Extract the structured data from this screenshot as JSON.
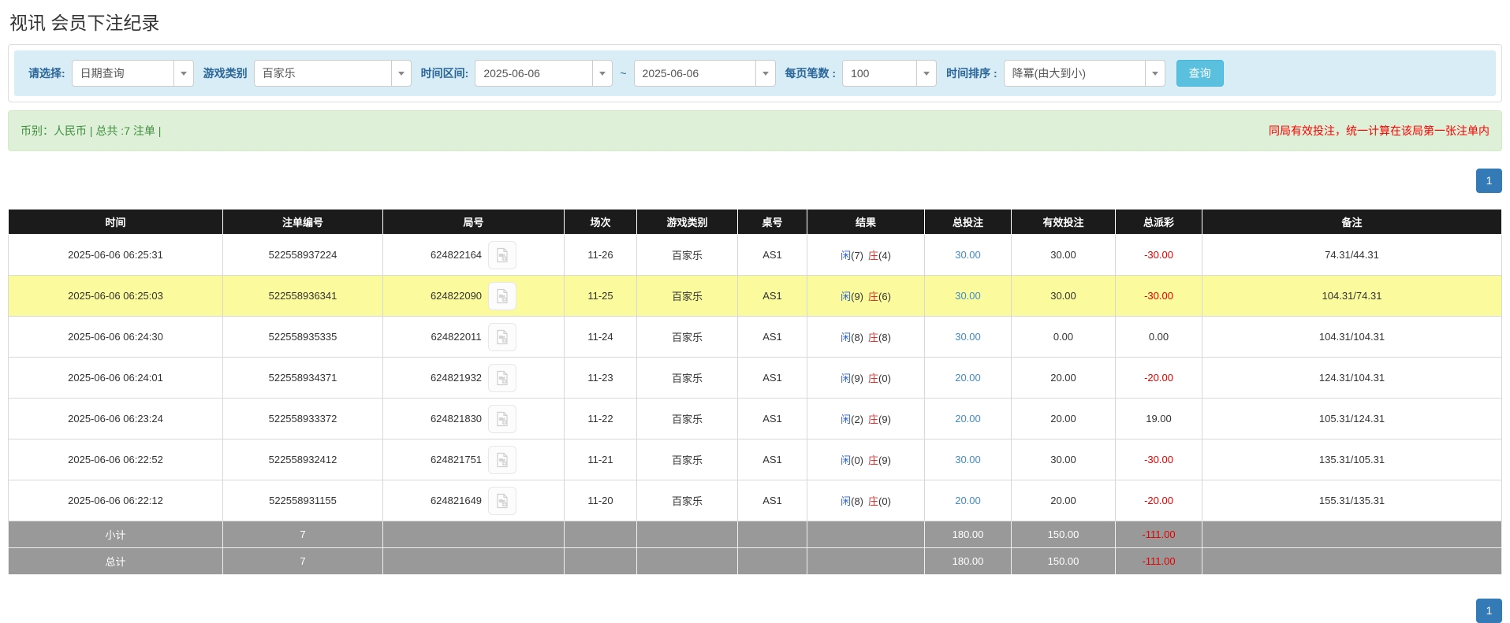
{
  "page": {
    "title": "视讯 会员下注纪录"
  },
  "filters": {
    "select_label": "请选择:",
    "select_value": "日期查询",
    "game_type_label": "游戏类别",
    "game_type_value": "百家乐",
    "date_range_label": "时间区间:",
    "date_from": "2025-06-06",
    "date_tilde": "~",
    "date_to": "2025-06-06",
    "page_size_label": "每页笔数 :",
    "page_size_value": "100",
    "sort_label": "时间排序 :",
    "sort_value": "降冪(由大到小)",
    "search_button": "查询"
  },
  "summary_bar": {
    "left_text": "币别：人民币 | 总共 :7 注单 |",
    "right_notice": "同局有效投注，统一计算在该局第一张注单内"
  },
  "pagination": {
    "page": "1"
  },
  "table": {
    "headers": [
      "时间",
      "注单编号",
      "局号",
      "场次",
      "游戏类别",
      "桌号",
      "结果",
      "总投注",
      "有效投注",
      "总派彩",
      "备注"
    ],
    "rows": [
      {
        "time": "2025-06-06 06:25:31",
        "bet_id": "522558937224",
        "round_id": "624822164",
        "session": "11-26",
        "game_type": "百家乐",
        "table_no": "AS1",
        "result": {
          "player_label": "闲",
          "player_score": "(7)",
          "banker_label": "庄",
          "banker_score": "(4)"
        },
        "total_bet": "30.00",
        "valid_bet": "30.00",
        "total_payout": "-30.00",
        "remark": "74.31/44.31",
        "highlighted": false
      },
      {
        "time": "2025-06-06 06:25:03",
        "bet_id": "522558936341",
        "round_id": "624822090",
        "session": "11-25",
        "game_type": "百家乐",
        "table_no": "AS1",
        "result": {
          "player_label": "闲",
          "player_score": "(9)",
          "banker_label": "庄",
          "banker_score": "(6)"
        },
        "total_bet": "30.00",
        "valid_bet": "30.00",
        "total_payout": "-30.00",
        "remark": "104.31/74.31",
        "highlighted": true
      },
      {
        "time": "2025-06-06 06:24:30",
        "bet_id": "522558935335",
        "round_id": "624822011",
        "session": "11-24",
        "game_type": "百家乐",
        "table_no": "AS1",
        "result": {
          "player_label": "闲",
          "player_score": "(8)",
          "banker_label": "庄",
          "banker_score": "(8)"
        },
        "total_bet": "30.00",
        "valid_bet": "0.00",
        "total_payout": "0.00",
        "remark": "104.31/104.31",
        "highlighted": false
      },
      {
        "time": "2025-06-06 06:24:01",
        "bet_id": "522558934371",
        "round_id": "624821932",
        "session": "11-23",
        "game_type": "百家乐",
        "table_no": "AS1",
        "result": {
          "player_label": "闲",
          "player_score": "(9)",
          "banker_label": "庄",
          "banker_score": "(0)"
        },
        "total_bet": "20.00",
        "valid_bet": "20.00",
        "total_payout": "-20.00",
        "remark": "124.31/104.31",
        "highlighted": false
      },
      {
        "time": "2025-06-06 06:23:24",
        "bet_id": "522558933372",
        "round_id": "624821830",
        "session": "11-22",
        "game_type": "百家乐",
        "table_no": "AS1",
        "result": {
          "player_label": "闲",
          "player_score": "(2)",
          "banker_label": "庄",
          "banker_score": "(9)"
        },
        "total_bet": "20.00",
        "valid_bet": "20.00",
        "total_payout": "19.00",
        "remark": "105.31/124.31",
        "highlighted": false
      },
      {
        "time": "2025-06-06 06:22:52",
        "bet_id": "522558932412",
        "round_id": "624821751",
        "session": "11-21",
        "game_type": "百家乐",
        "table_no": "AS1",
        "result": {
          "player_label": "闲",
          "player_score": "(0)",
          "banker_label": "庄",
          "banker_score": "(9)"
        },
        "total_bet": "30.00",
        "valid_bet": "30.00",
        "total_payout": "-30.00",
        "remark": "135.31/105.31",
        "highlighted": false
      },
      {
        "time": "2025-06-06 06:22:12",
        "bet_id": "522558931155",
        "round_id": "624821649",
        "session": "11-20",
        "game_type": "百家乐",
        "table_no": "AS1",
        "result": {
          "player_label": "闲",
          "player_score": "(8)",
          "banker_label": "庄",
          "banker_score": "(0)"
        },
        "total_bet": "20.00",
        "valid_bet": "20.00",
        "total_payout": "-20.00",
        "remark": "155.31/135.31",
        "highlighted": false
      }
    ],
    "subtotal": {
      "label": "小计",
      "count": "7",
      "total_bet": "180.00",
      "valid_bet": "150.00",
      "total_payout": "-111.00"
    },
    "total": {
      "label": "总计",
      "count": "7",
      "total_bet": "180.00",
      "valid_bet": "150.00",
      "total_payout": "-111.00"
    }
  },
  "colors": {
    "accent_blue": "#337ab7",
    "search_button_blue": "#5bc0de",
    "filter_bar_blue": "#d9edf7",
    "alert_green_bg": "#dff0d8",
    "alert_green_text": "#3f8f3f",
    "notice_red": "#ff0000",
    "header_black": "#1b1b1b",
    "highlight_yellow": "#fbfb9d",
    "summary_gray": "#999999",
    "link_blue": "#428bca",
    "player_blue": "#3366cc",
    "banker_red": "#e03131",
    "negative_red": "#e60000"
  }
}
